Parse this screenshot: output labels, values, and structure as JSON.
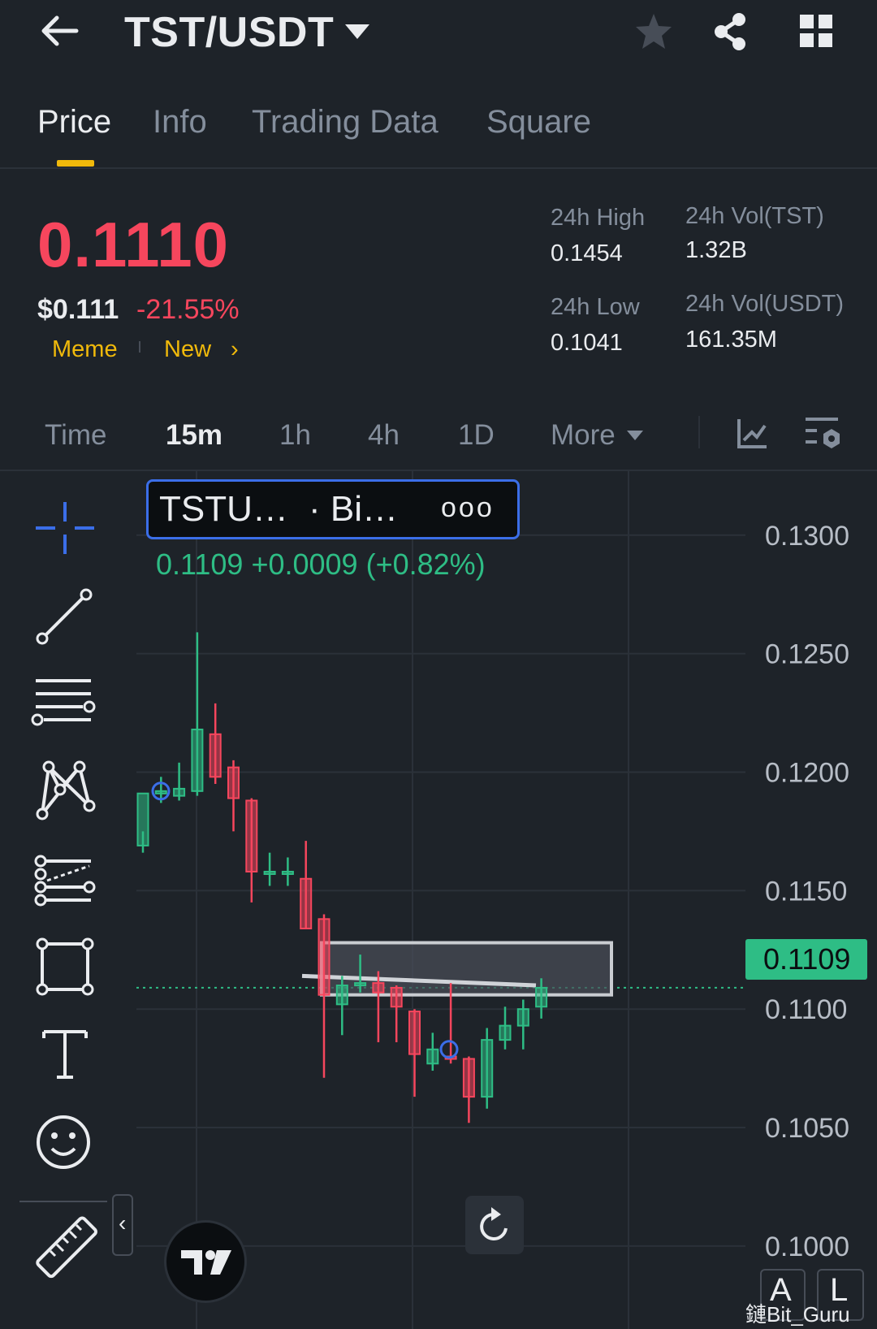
{
  "header": {
    "pair": "TST/USDT",
    "back_icon": "arrow-left-icon",
    "star_icon": "star-icon",
    "share_icon": "share-icon",
    "grid_icon": "grid-icon"
  },
  "tabs": [
    {
      "label": "Price",
      "active": true
    },
    {
      "label": "Info",
      "active": false
    },
    {
      "label": "Trading Data",
      "active": false
    },
    {
      "label": "Square",
      "active": false
    }
  ],
  "ticker": {
    "last_price": "0.1110",
    "usd_price": "$0.111",
    "change_pct": "-21.55%",
    "tags": [
      "Meme",
      "New"
    ],
    "chevron": "›",
    "stats": {
      "high_label": "24h High",
      "high_value": "0.1454",
      "low_label": "24h Low",
      "low_value": "0.1041",
      "vol_base_label": "24h Vol(TST)",
      "vol_base_value": "1.32B",
      "vol_quote_label": "24h Vol(USDT)",
      "vol_quote_value": "161.35M"
    }
  },
  "intervals": {
    "items": [
      "Time",
      "15m",
      "1h",
      "4h",
      "1D",
      "More"
    ],
    "selected": "15m"
  },
  "legend": {
    "symbol": "TSTU…",
    "source": "· Bi…",
    "more": "ooo",
    "ohlc": "0.1109  +0.0009 (+0.82%)"
  },
  "chart_data": {
    "type": "candlestick",
    "y_ticks": [
      "0.1300",
      "0.1250",
      "0.1200",
      "0.1150",
      "0.1100",
      "0.1050",
      "0.1000"
    ],
    "ylim": [
      0.0965,
      0.1327
    ],
    "current_price": "0.1109",
    "colors": {
      "up": "#2ebd85",
      "down": "#f6465d"
    },
    "candles": [
      {
        "o": 0.1169,
        "h": 0.1175,
        "l": 0.1166,
        "c": 0.1191
      },
      {
        "o": 0.1192,
        "h": 0.1198,
        "l": 0.1187,
        "c": 0.1192
      },
      {
        "o": 0.119,
        "h": 0.1204,
        "l": 0.1188,
        "c": 0.1193
      },
      {
        "o": 0.1192,
        "h": 0.1259,
        "l": 0.119,
        "c": 0.1218
      },
      {
        "o": 0.1216,
        "h": 0.1229,
        "l": 0.1195,
        "c": 0.1198
      },
      {
        "o": 0.1202,
        "h": 0.1205,
        "l": 0.1175,
        "c": 0.1189
      },
      {
        "o": 0.1188,
        "h": 0.1189,
        "l": 0.1145,
        "c": 0.1158
      },
      {
        "o": 0.1158,
        "h": 0.1166,
        "l": 0.1152,
        "c": 0.1158
      },
      {
        "o": 0.1158,
        "h": 0.1164,
        "l": 0.1152,
        "c": 0.1158
      },
      {
        "o": 0.1155,
        "h": 0.1171,
        "l": 0.1134,
        "c": 0.1134
      },
      {
        "o": 0.1138,
        "h": 0.114,
        "l": 0.1071,
        "c": 0.1106
      },
      {
        "o": 0.1102,
        "h": 0.1114,
        "l": 0.1089,
        "c": 0.111
      },
      {
        "o": 0.1111,
        "h": 0.1123,
        "l": 0.1107,
        "c": 0.1111
      },
      {
        "o": 0.1111,
        "h": 0.1116,
        "l": 0.1086,
        "c": 0.1107
      },
      {
        "o": 0.1109,
        "h": 0.111,
        "l": 0.1086,
        "c": 0.1101
      },
      {
        "o": 0.1099,
        "h": 0.11,
        "l": 0.1063,
        "c": 0.1081
      },
      {
        "o": 0.1077,
        "h": 0.109,
        "l": 0.1074,
        "c": 0.1083
      },
      {
        "o": 0.108,
        "h": 0.1111,
        "l": 0.1077,
        "c": 0.1079
      },
      {
        "o": 0.1079,
        "h": 0.108,
        "l": 0.1052,
        "c": 0.1063
      },
      {
        "o": 0.1063,
        "h": 0.1092,
        "l": 0.1058,
        "c": 0.1087
      },
      {
        "o": 0.1087,
        "h": 0.1101,
        "l": 0.1083,
        "c": 0.1093
      },
      {
        "o": 0.1093,
        "h": 0.1104,
        "l": 0.1083,
        "c": 0.11
      },
      {
        "o": 0.1101,
        "h": 0.1113,
        "l": 0.1096,
        "c": 0.1109
      }
    ]
  },
  "tools": [
    "crosshair-icon",
    "trend-line-icon",
    "horizontal-lines-icon",
    "pattern-icon",
    "fib-icon",
    "rectangle-icon",
    "text-icon",
    "emoji-icon",
    "ruler-icon"
  ],
  "chart_controls": {
    "collapse": "‹",
    "auto_label": "A",
    "log_label": "L",
    "reset_icon": "reset-icon",
    "logo": "tradingview-logo-icon"
  },
  "watermark": "鏈Bit_Guru"
}
